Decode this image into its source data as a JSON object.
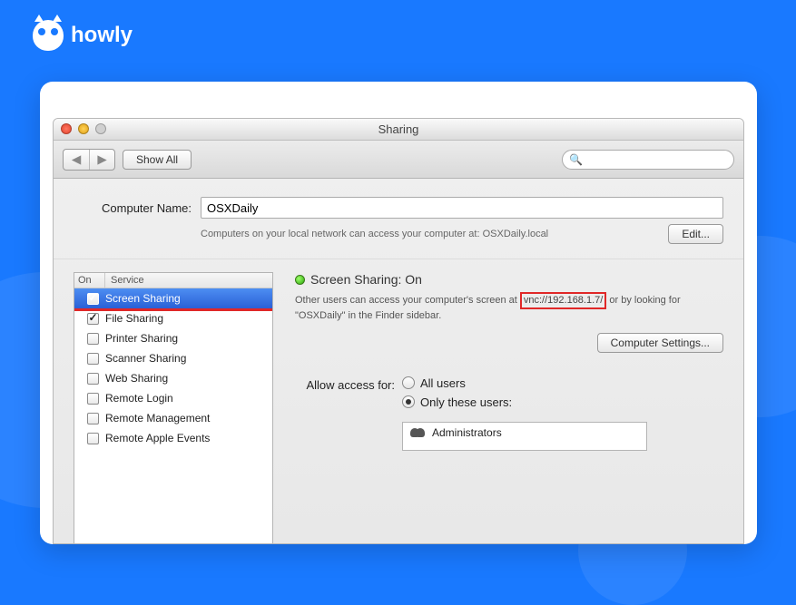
{
  "brand": {
    "name": "howly"
  },
  "window": {
    "title": "Sharing",
    "show_all_label": "Show All",
    "search_placeholder": ""
  },
  "computer_name": {
    "label": "Computer Name:",
    "value": "OSXDaily",
    "hint": "Computers on your local network can access your computer at: OSXDaily.local",
    "edit_label": "Edit..."
  },
  "services": {
    "header_on": "On",
    "header_service": "Service",
    "items": [
      {
        "label": "Screen Sharing",
        "checked": true,
        "selected": true
      },
      {
        "label": "File Sharing",
        "checked": true,
        "selected": false
      },
      {
        "label": "Printer Sharing",
        "checked": false,
        "selected": false
      },
      {
        "label": "Scanner Sharing",
        "checked": false,
        "selected": false
      },
      {
        "label": "Web Sharing",
        "checked": false,
        "selected": false
      },
      {
        "label": "Remote Login",
        "checked": false,
        "selected": false
      },
      {
        "label": "Remote Management",
        "checked": false,
        "selected": false
      },
      {
        "label": "Remote Apple Events",
        "checked": false,
        "selected": false
      }
    ]
  },
  "detail": {
    "status_label": "Screen Sharing: On",
    "description_pre": "Other users can access your computer's screen at ",
    "vnc_url": "vnc://192.168.1.7/",
    "description_post": " or by looking for \"OSXDaily\" in the Finder sidebar.",
    "computer_settings_label": "Computer Settings...",
    "access_label": "Allow access for:",
    "access_options": {
      "all_users": "All users",
      "only_these": "Only these users:"
    },
    "users": [
      "Administrators"
    ]
  }
}
